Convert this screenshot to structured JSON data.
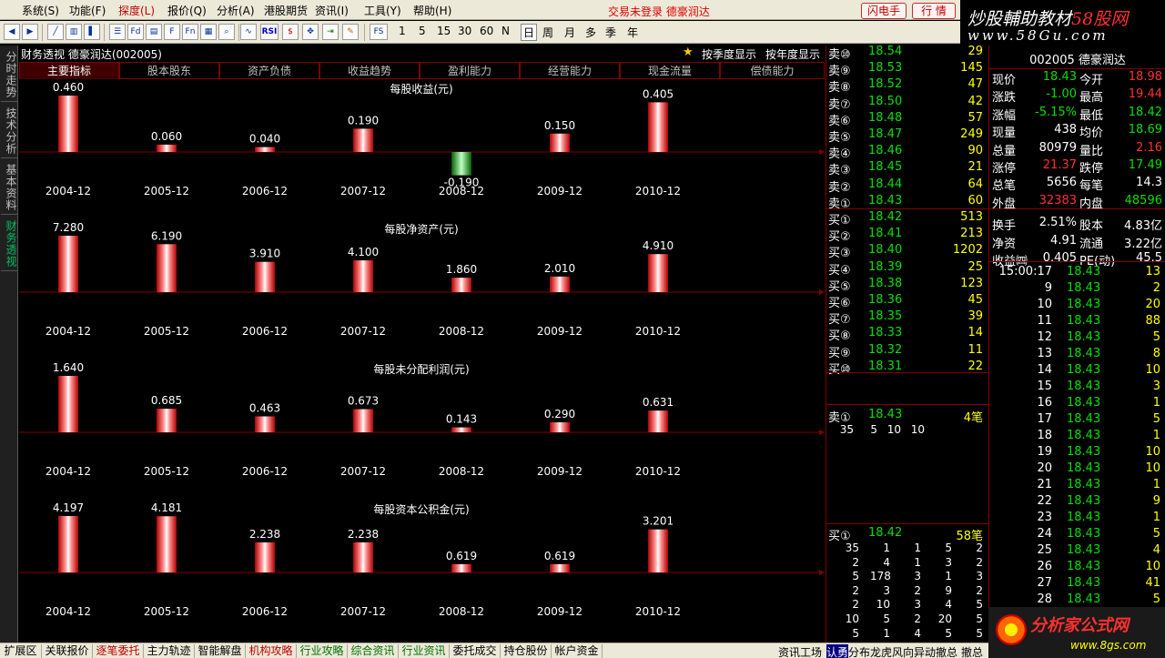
{
  "menu": {
    "items": [
      "系统(S)",
      "功能(F)",
      "探度(L)",
      "报价(Q)",
      "分析(A)",
      "港股期货",
      "资讯(I)",
      "工具(Y)",
      "帮助(H)"
    ],
    "login_status": "交易未登录  德豪润达",
    "btn_flash": "闪电手",
    "btn_market": "行  情"
  },
  "toolbar": {
    "periods": [
      "1",
      "5",
      "15",
      "30",
      "60",
      "N",
      "日",
      "周",
      "月",
      "多",
      "季",
      "年"
    ]
  },
  "brand": {
    "line1_a": "炒股輔助教材",
    "line1_b": "58股网",
    "line2": "www.58Gu.com"
  },
  "left_tabs": [
    "分时走势",
    "技术分析",
    "基本资料",
    "财务透视"
  ],
  "finance": {
    "title": "财务透视  德豪润达(002005)",
    "opt_quarter": "按季度显示",
    "opt_year": "按年度显示",
    "tabs": [
      "主要指标",
      "股本股东",
      "资产负债",
      "收益趋势",
      "盈利能力",
      "经营能力",
      "现金流量",
      "偿债能力"
    ]
  },
  "chart_data": [
    {
      "type": "bar",
      "title": "每股收益(元)",
      "categories": [
        "2004-12",
        "2005-12",
        "2006-12",
        "2007-12",
        "2008-12",
        "2009-12",
        "2010-12"
      ],
      "values": [
        0.46,
        0.06,
        0.04,
        0.19,
        -0.19,
        0.15,
        0.405
      ],
      "labels": [
        "0.460",
        "0.060",
        "0.040",
        "0.190",
        "-0.190",
        "0.150",
        "0.405"
      ]
    },
    {
      "type": "bar",
      "title": "每股净资产(元)",
      "categories": [
        "2004-12",
        "2005-12",
        "2006-12",
        "2007-12",
        "2008-12",
        "2009-12",
        "2010-12"
      ],
      "values": [
        7.28,
        6.19,
        3.91,
        4.1,
        1.86,
        2.01,
        4.91
      ],
      "labels": [
        "7.280",
        "6.190",
        "3.910",
        "4.100",
        "1.860",
        "2.010",
        "4.910"
      ]
    },
    {
      "type": "bar",
      "title": "每股未分配利润(元)",
      "categories": [
        "2004-12",
        "2005-12",
        "2006-12",
        "2007-12",
        "2008-12",
        "2009-12",
        "2010-12"
      ],
      "values": [
        1.64,
        0.685,
        0.463,
        0.673,
        0.143,
        0.29,
        0.631
      ],
      "labels": [
        "1.640",
        "0.685",
        "0.463",
        "0.673",
        "0.143",
        "0.290",
        "0.631"
      ]
    },
    {
      "type": "bar",
      "title": "每股资本公积金(元)",
      "categories": [
        "2004-12",
        "2005-12",
        "2006-12",
        "2007-12",
        "2008-12",
        "2009-12",
        "2010-12"
      ],
      "values": [
        4.197,
        4.181,
        2.238,
        2.238,
        0.619,
        0.619,
        3.201
      ],
      "labels": [
        "4.197",
        "4.181",
        "2.238",
        "2.238",
        "0.619",
        "0.619",
        "3.201"
      ]
    }
  ],
  "order_book": {
    "sells": [
      {
        "label": "卖⑩",
        "price": "18.54",
        "vol": "29"
      },
      {
        "label": "卖⑨",
        "price": "18.53",
        "vol": "145"
      },
      {
        "label": "卖⑧",
        "price": "18.52",
        "vol": "47"
      },
      {
        "label": "卖⑦",
        "price": "18.50",
        "vol": "42"
      },
      {
        "label": "卖⑥",
        "price": "18.48",
        "vol": "57"
      },
      {
        "label": "卖⑤",
        "price": "18.47",
        "vol": "249"
      },
      {
        "label": "卖④",
        "price": "18.46",
        "vol": "90"
      },
      {
        "label": "卖③",
        "price": "18.45",
        "vol": "21"
      },
      {
        "label": "卖②",
        "price": "18.44",
        "vol": "64"
      },
      {
        "label": "卖①",
        "price": "18.43",
        "vol": "60"
      }
    ],
    "buys": [
      {
        "label": "买①",
        "price": "18.42",
        "vol": "513"
      },
      {
        "label": "买②",
        "price": "18.41",
        "vol": "213"
      },
      {
        "label": "买③",
        "price": "18.40",
        "vol": "1202"
      },
      {
        "label": "买④",
        "price": "18.39",
        "vol": "25"
      },
      {
        "label": "买⑤",
        "price": "18.38",
        "vol": "123"
      },
      {
        "label": "买⑥",
        "price": "18.36",
        "vol": "45"
      },
      {
        "label": "买⑦",
        "price": "18.35",
        "vol": "39"
      },
      {
        "label": "买⑧",
        "price": "18.33",
        "vol": "14"
      },
      {
        "label": "买⑨",
        "price": "18.32",
        "vol": "11"
      },
      {
        "label": "买⑩",
        "price": "18.31",
        "vol": "22"
      }
    ],
    "sell1_queue": {
      "label": "卖①",
      "price": "18.43",
      "count": "4笔",
      "orders": [
        "35",
        "5",
        "10",
        "10"
      ]
    },
    "buy1_queue": {
      "label": "买①",
      "price": "18.42",
      "count": "58笔",
      "orders": [
        [
          "35",
          "1",
          "1",
          "5",
          "2"
        ],
        [
          "2",
          "4",
          "1",
          "3",
          "2"
        ],
        [
          "5",
          "178",
          "3",
          "1",
          "3"
        ],
        [
          "2",
          "3",
          "2",
          "9",
          "2"
        ],
        [
          "2",
          "10",
          "3",
          "4",
          "5"
        ],
        [
          "10",
          "5",
          "2",
          "20",
          "5"
        ],
        [
          "5",
          "1",
          "4",
          "5",
          "5"
        ]
      ]
    }
  },
  "quote": {
    "code": "002005 德豪润达",
    "rows": [
      {
        "l1": "现价",
        "v1": "18.43",
        "c1": "#00e000",
        "l2": "今开",
        "v2": "18.98",
        "c2": "#ff3030"
      },
      {
        "l1": "涨跌",
        "v1": "-1.00",
        "c1": "#00e000",
        "l2": "最高",
        "v2": "19.44",
        "c2": "#ff3030"
      },
      {
        "l1": "涨幅",
        "v1": "-5.15%",
        "c1": "#00e000",
        "l2": "最低",
        "v2": "18.42",
        "c2": "#00e000"
      },
      {
        "l1": "现量",
        "v1": "438",
        "c1": "#ffffff",
        "l2": "均价",
        "v2": "18.69",
        "c2": "#00e000"
      },
      {
        "l1": "总量",
        "v1": "80979",
        "c1": "#ffffff",
        "l2": "量比",
        "v2": "2.16",
        "c2": "#ff3030"
      },
      {
        "l1": "涨停",
        "v1": "21.37",
        "c1": "#ff3030",
        "l2": "跌停",
        "v2": "17.49",
        "c2": "#00e000"
      },
      {
        "l1": "总笔",
        "v1": "5656",
        "c1": "#ffffff",
        "l2": "每笔",
        "v2": "14.3",
        "c2": "#ffffff"
      },
      {
        "l1": "外盘",
        "v1": "32383",
        "c1": "#ff3030",
        "l2": "内盘",
        "v2": "48596",
        "c2": "#00e000"
      },
      {
        "l1": "换手",
        "v1": "2.51%",
        "c1": "#ffffff",
        "l2": "股本",
        "v2": "4.83亿",
        "c2": "#ffffff"
      },
      {
        "l1": "净资",
        "v1": "4.91",
        "c1": "#ffffff",
        "l2": "流通",
        "v2": "3.22亿",
        "c2": "#ffffff"
      },
      {
        "l1": "收益㈣",
        "v1": "0.405",
        "c1": "#ffffff",
        "l2": "PE(动)",
        "v2": "45.5",
        "c2": "#ffffff"
      }
    ],
    "ticks": [
      {
        "t": "15:00:17",
        "p": "18.43",
        "v": "13"
      },
      {
        "t": "9",
        "p": "18.43",
        "v": "2"
      },
      {
        "t": "10",
        "p": "18.43",
        "v": "20"
      },
      {
        "t": "11",
        "p": "18.43",
        "v": "88"
      },
      {
        "t": "12",
        "p": "18.43",
        "v": "5"
      },
      {
        "t": "13",
        "p": "18.43",
        "v": "8"
      },
      {
        "t": "14",
        "p": "18.43",
        "v": "10"
      },
      {
        "t": "15",
        "p": "18.43",
        "v": "3"
      },
      {
        "t": "16",
        "p": "18.43",
        "v": "1"
      },
      {
        "t": "17",
        "p": "18.43",
        "v": "5"
      },
      {
        "t": "18",
        "p": "18.43",
        "v": "1"
      },
      {
        "t": "19",
        "p": "18.43",
        "v": "10"
      },
      {
        "t": "20",
        "p": "18.43",
        "v": "10"
      },
      {
        "t": "21",
        "p": "18.43",
        "v": "1"
      },
      {
        "t": "22",
        "p": "18.43",
        "v": "9"
      },
      {
        "t": "23",
        "p": "18.43",
        "v": "1"
      },
      {
        "t": "24",
        "p": "18.43",
        "v": "5"
      },
      {
        "t": "25",
        "p": "18.43",
        "v": "4"
      },
      {
        "t": "26",
        "p": "18.43",
        "v": "10"
      },
      {
        "t": "27",
        "p": "18.43",
        "v": "41"
      },
      {
        "t": "28",
        "p": "18.43",
        "v": "5"
      }
    ]
  },
  "logo2": {
    "name": "分析家公式网",
    "url": "www.8gs.com"
  },
  "bottom_tabs": [
    "扩展区",
    "关联报价",
    "逐笔委托",
    "主力轨迹",
    "智能解盘",
    "机构攻略",
    "行业攻略",
    "综合资讯",
    "行业资讯",
    "委托成交",
    "持仓股份",
    "帐户资金"
  ],
  "bottom_right": [
    "资讯工场",
    "认勇",
    "分布",
    "龙虎",
    "风向",
    "异动",
    "撤总",
    "撤总"
  ],
  "colors": {
    "up": "#ff3030",
    "down": "#00e000",
    "grid": "#800000",
    "bg": "#000000"
  }
}
